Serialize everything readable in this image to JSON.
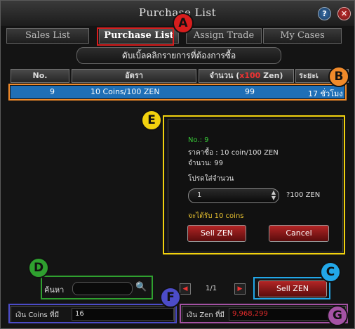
{
  "window": {
    "title": "Purchase List"
  },
  "tabs": [
    {
      "label": "Sales List"
    },
    {
      "label": "Purchase List"
    },
    {
      "label": "Assign Trade"
    },
    {
      "label": "My Cases"
    }
  ],
  "banner": "ดับเบิ้ลคลิกรายการที่ต้องการซื้อ",
  "columns": {
    "no": "No.",
    "rate": "อัตรา",
    "qty_prefix": "จำนวน (",
    "qty_x": "x100",
    "qty_suffix": " Zen)",
    "time": "ระยะเ"
  },
  "row": {
    "no": "9",
    "rate": "10 Coins/100 ZEN",
    "qty": "99",
    "time": "17 ชั่วโมง"
  },
  "dialog": {
    "no": "No.: 9",
    "price": "ราคาซื้อ : 10 coin/100 ZEN",
    "amount": "จำนวน: 99",
    "prompt": "โปรดใส่จำนวน",
    "qty_value": "1",
    "unit": "?100 ZEN",
    "receive": "จะได้รับ 10 coins",
    "sell_label": "Sell ZEN",
    "cancel_label": "Cancel"
  },
  "search": {
    "label": "ค้นหา"
  },
  "pagination": {
    "page": "1/1"
  },
  "sell_button": "Sell ZEN",
  "footer": {
    "coins_label": "เงิน Coins ที่มี",
    "coins_value": "16",
    "zen_label": "เงิน Zen ที่มี",
    "zen_value": "9,968,299"
  },
  "markers": [
    "A",
    "B",
    "C",
    "D",
    "E",
    "F",
    "G"
  ],
  "colors": {
    "highlight": "#1f6fb6",
    "zen_value": "#e32b2b",
    "coins_green": "#37c837",
    "accent_red": "#c62828"
  }
}
